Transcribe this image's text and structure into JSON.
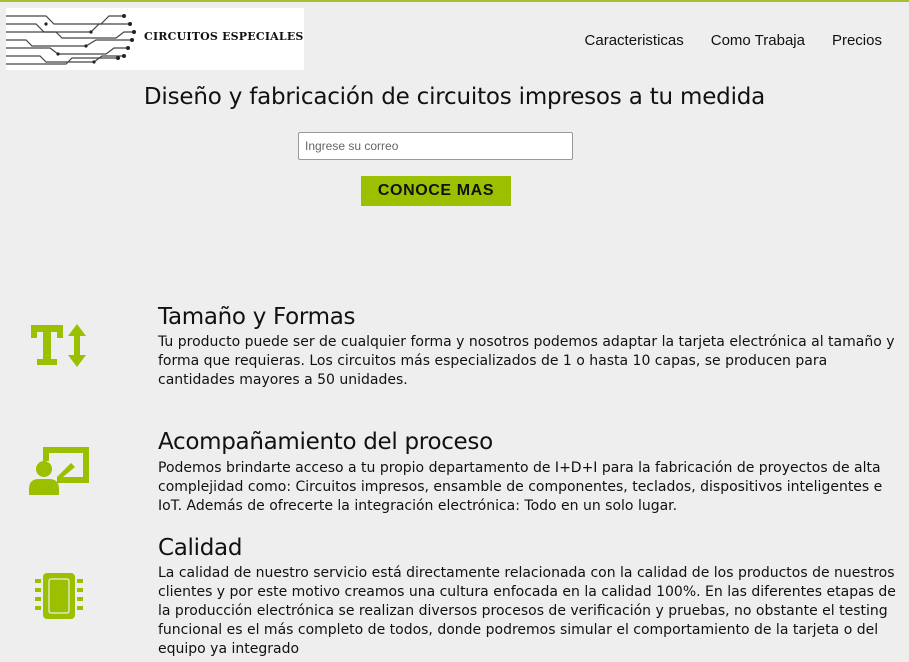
{
  "header": {
    "logo_text": "CIRCUITOS ESPECIALES",
    "nav": [
      "Caracteristicas",
      "Como Trabaja",
      "Precios"
    ]
  },
  "hero": {
    "title": "Diseño y fabricación de circuitos impresos a tu medida",
    "email_placeholder": "Ingrese su correo",
    "email_value": "",
    "cta_label": "CONOCE MAS"
  },
  "features": [
    {
      "icon": "text-height-icon",
      "title": "Tamaño y Formas",
      "text": "Tu producto puede ser de cualquier forma y nosotros podemos adaptar la tarjeta electrónica al tamaño y forma que requieras. Los circuitos más especializados de 1 o hasta 10 capas, se producen para cantidades mayores a 50 unidades."
    },
    {
      "icon": "user-presentation-icon",
      "title": "Acompañamiento del proceso",
      "text": "Podemos brindarte acceso a tu propio departamento de I+D+I para la fabricación de proyectos de alta complejidad como: Circuitos impresos, ensamble de componentes, teclados, dispositivos inteligentes e IoT. Además de ofrecerte la integración electrónica: Todo en un solo lugar."
    },
    {
      "icon": "microchip-icon",
      "title": "Calidad",
      "text": "La calidad de nuestro servicio está directamente relacionada con la calidad de los productos de nuestros clientes y por este motivo creamos una cultura enfocada en la calidad 100%. En las diferentes etapas de la producción electrónica se realizan diversos procesos de verificación y pruebas, no obstante el testing funcional es el más completo de todos, donde podremos simular el comportamiento de la tarjeta o del equipo ya integrado"
    }
  ],
  "colors": {
    "accent": "#9ac000",
    "background": "#eeeeee",
    "top_border": "#a8c030"
  }
}
